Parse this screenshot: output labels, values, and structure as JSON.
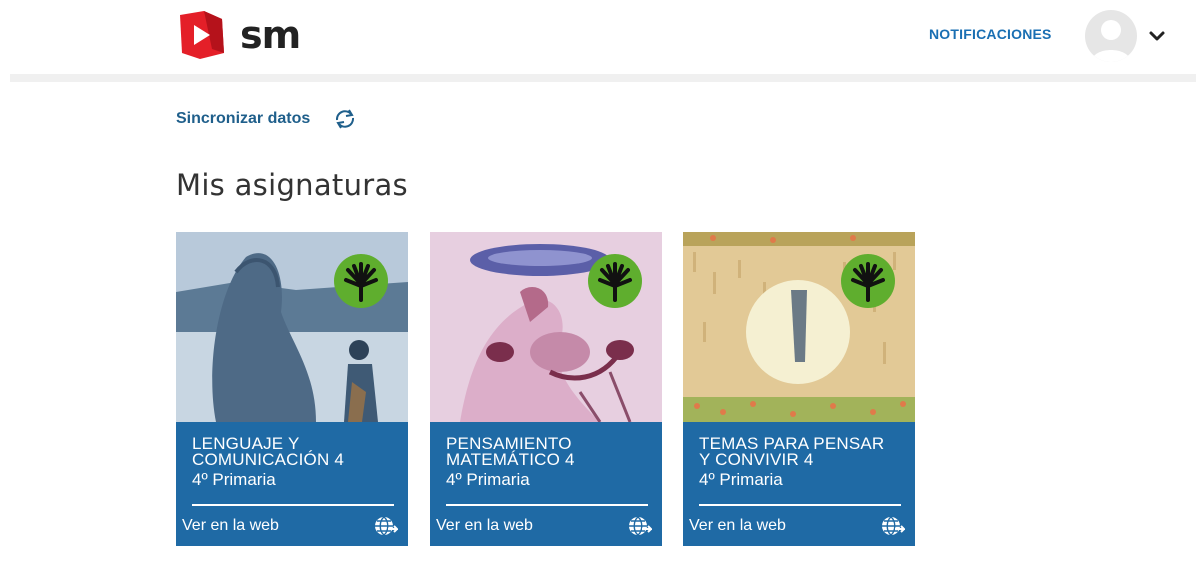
{
  "header": {
    "logo_text": "sm",
    "notifications_label": "NOTIFICACIONES",
    "brand_color": "#e41f28",
    "accent_color": "#1a6fb3"
  },
  "sync": {
    "label": "Sincronizar datos",
    "icon": "sync-icon"
  },
  "main": {
    "title": "Mis asignaturas",
    "cards": [
      {
        "title": "LENGUAJE Y COMUNICACIÓN 4",
        "level": "4º Primaria",
        "link": "Ver en la web",
        "badge_icon": "hand-badge-icon",
        "link_icon": "globe-icon"
      },
      {
        "title": "PENSAMIENTO MATEMÁTICO 4",
        "level": "4º Primaria",
        "link": "Ver en la web",
        "badge_icon": "hand-badge-icon",
        "link_icon": "globe-icon"
      },
      {
        "title": "TEMAS PARA PENSAR Y CONVIVIR 4",
        "level": "4º Primaria",
        "link": "Ver en la web",
        "badge_icon": "hand-badge-icon",
        "link_icon": "globe-icon"
      }
    ],
    "card_color": "#1f6aa5",
    "badge_color": "#5fae2e"
  }
}
